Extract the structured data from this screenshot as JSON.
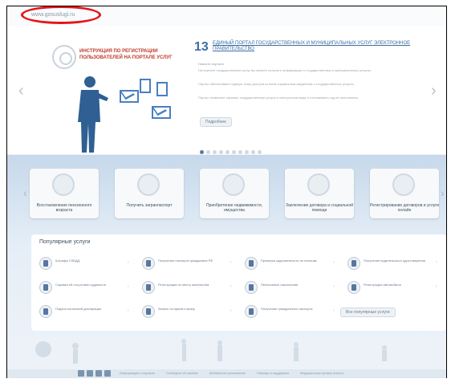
{
  "browser": {
    "url": "www.gosuslugi.ru"
  },
  "hero": {
    "title": "ИНСТРУКЦИЯ ПО РЕГИСТРАЦИИ ПОЛЬЗОВАТЕЛЕЙ НА ПОРТАЛЕ УСЛУГ",
    "news_number": "13",
    "news_title": "ЕДИНЫЙ ПОРТАЛ ГОСУДАРСТВЕННЫХ И МУНИЦИПАЛЬНЫХ УСЛУГ ЭЛЕКТРОННОЕ ПРАВИТЕЛЬСТВО",
    "news_meta": "Новости портала",
    "news_paragraphs": [
      "На портале государственных услуг вы можете получить информацию о государственных и муниципальных услугах.",
      "Портал обеспечивает единую точку доступа ко всем справочным сведениям о государственных услугах.",
      "Портал позволяет заказать государственную услугу в электронном виде и отслеживать ход ее исполнения."
    ],
    "more_label": "Подробнее"
  },
  "tiles": [
    {
      "label": "Восстановление пенсионного возраста",
      "icon": "pension-icon"
    },
    {
      "label": "Получить загранпаспорт",
      "icon": "passport-icon"
    },
    {
      "label": "Приобретение недвижимости, имущества",
      "icon": "property-icon"
    },
    {
      "label": "Заключение договора и социальной помощи",
      "icon": "contract-icon"
    },
    {
      "label": "Регистрирование договоров и услуги онлайн",
      "icon": "discount-icon"
    }
  ],
  "popular": {
    "title": "Популярные услуги",
    "services": [
      {
        "label": "Штрафы ГИБДД"
      },
      {
        "label": "Получение паспорта гражданина РФ"
      },
      {
        "label": "Проверка задолженности по налогам"
      },
      {
        "label": "Получение водительского удостоверения"
      },
      {
        "label": "Справка об отсутствии судимости"
      },
      {
        "label": "Регистрация по месту жительства"
      },
      {
        "label": "Пенсионные накопления"
      },
      {
        "label": "Регистрация автомобиля"
      },
      {
        "label": "Подача налоговой декларации"
      },
      {
        "label": "Запись на прием к врачу"
      },
      {
        "label": "Получение гражданского паспорта"
      }
    ],
    "all_label": "Все популярные услуги"
  },
  "footer": {
    "links": [
      "Информация о портале",
      "Сообщить об ошибке",
      "Мобильное приложение",
      "Помощь и поддержка",
      "Федеральные органы власти"
    ]
  },
  "colors": {
    "accent": "#3a6ea5",
    "highlight_oval": "#e3151a",
    "title_red": "#c0392b"
  }
}
